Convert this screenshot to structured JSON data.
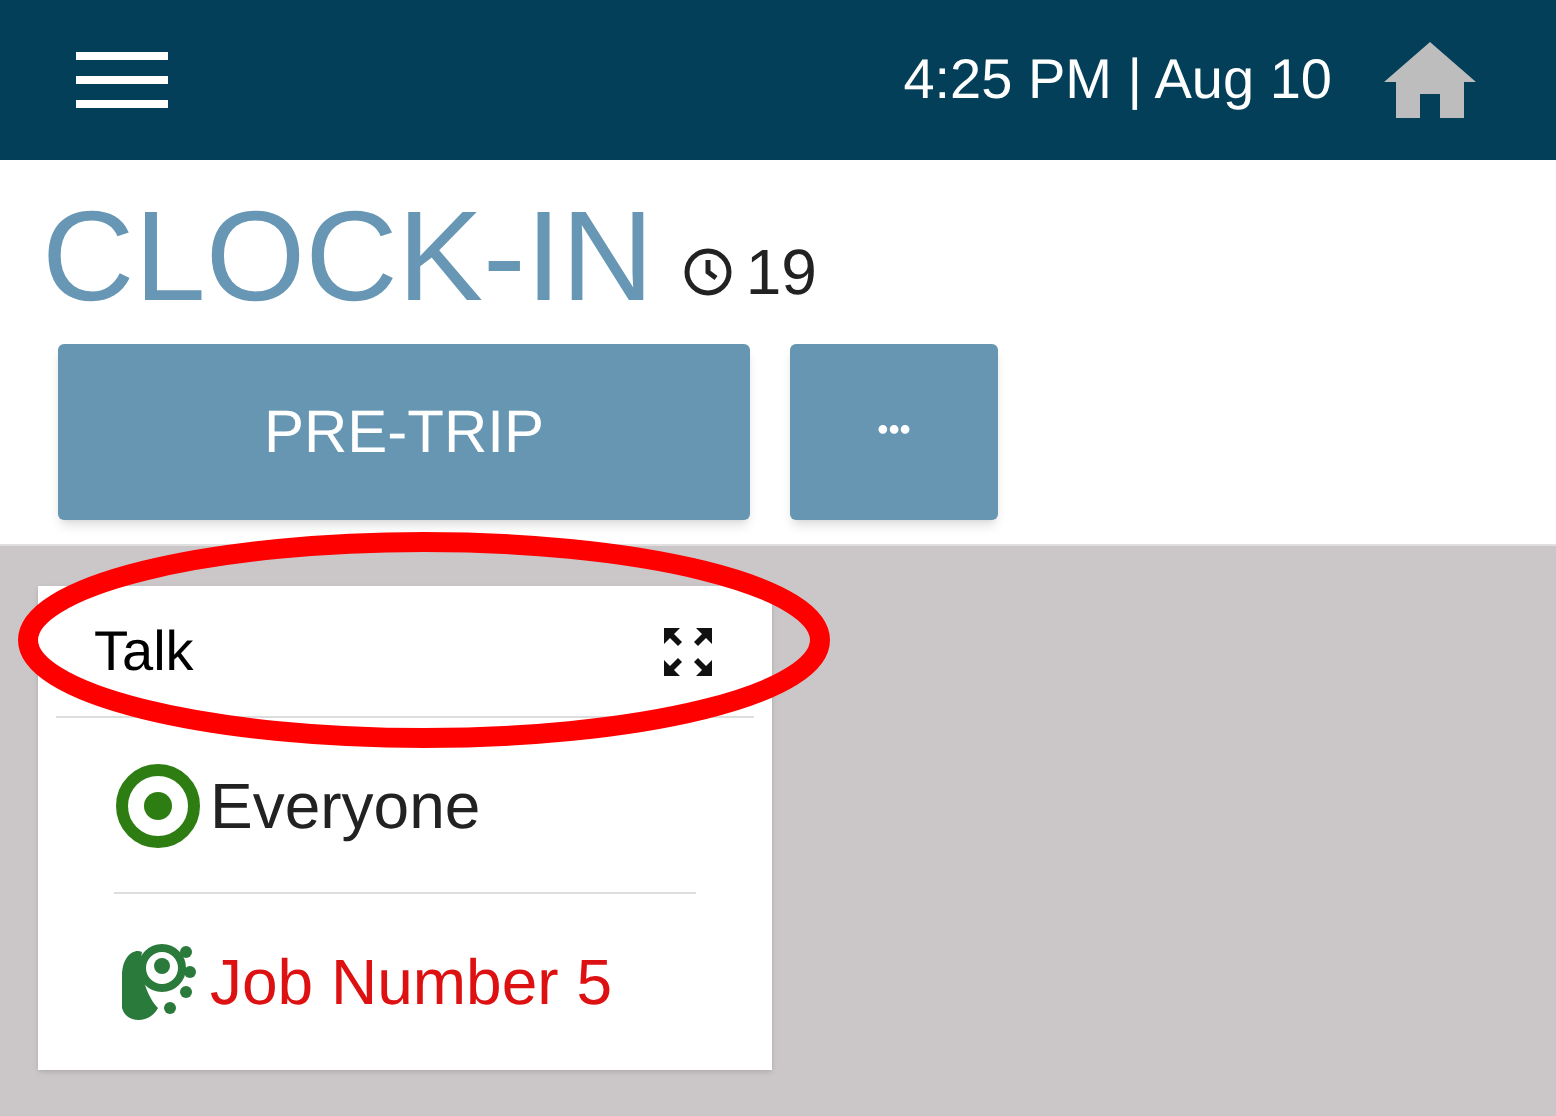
{
  "header": {
    "datetime": "4:25 PM | Aug 10"
  },
  "title": "CLOCK-IN",
  "timer": "19",
  "buttons": [
    {
      "label": "PRE-TRIP",
      "kind": "wide"
    },
    {
      "label": "•••",
      "kind": "narrow"
    }
  ],
  "panel": {
    "title": "Talk",
    "items": [
      {
        "label": "Everyone",
        "kind": "broadcast",
        "color": "#222222"
      },
      {
        "label": "Job Number 5",
        "kind": "group",
        "color": "#dd1111"
      }
    ]
  },
  "annotation": {
    "kind": "ellipse",
    "color": "#ff0000"
  }
}
